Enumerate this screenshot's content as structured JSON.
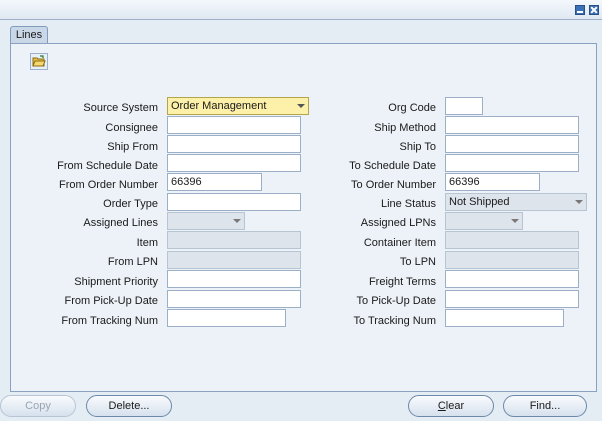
{
  "tabs": [
    {
      "label": "Lines",
      "active": true
    }
  ],
  "toolbar": {
    "icon": "folder-open-icon"
  },
  "form": {
    "left": [
      {
        "label": "Source System",
        "value": "Order Management",
        "type": "select",
        "state": "highlight"
      },
      {
        "label": "Consignee",
        "value": "",
        "type": "text",
        "state": "normal"
      },
      {
        "label": "Ship From",
        "value": "",
        "type": "text",
        "state": "normal"
      },
      {
        "label": "From Schedule Date",
        "value": "",
        "type": "text",
        "state": "normal"
      },
      {
        "label": "From Order Number",
        "value": "66396",
        "type": "text",
        "state": "normal"
      },
      {
        "label": "Order Type",
        "value": "",
        "type": "text",
        "state": "normal"
      },
      {
        "label": "Assigned Lines",
        "value": "",
        "type": "select",
        "state": "disabled"
      },
      {
        "label": "Item",
        "value": "",
        "type": "text",
        "state": "disabled"
      },
      {
        "label": "From LPN",
        "value": "",
        "type": "text",
        "state": "disabled"
      },
      {
        "label": "Shipment Priority",
        "value": "",
        "type": "text",
        "state": "normal"
      },
      {
        "label": "From Pick-Up Date",
        "value": "",
        "type": "text",
        "state": "normal"
      },
      {
        "label": "From Tracking Num",
        "value": "",
        "type": "text",
        "state": "normal"
      }
    ],
    "right": [
      {
        "label": "Org Code",
        "value": "",
        "type": "text",
        "state": "normal"
      },
      {
        "label": "Ship Method",
        "value": "",
        "type": "text",
        "state": "normal"
      },
      {
        "label": "Ship To",
        "value": "",
        "type": "text",
        "state": "normal"
      },
      {
        "label": "To Schedule Date",
        "value": "",
        "type": "text",
        "state": "normal"
      },
      {
        "label": "To Order Number",
        "value": "66396",
        "type": "text",
        "state": "normal"
      },
      {
        "label": "Line Status",
        "value": "Not Shipped",
        "type": "select",
        "state": "disabled"
      },
      {
        "label": "Assigned LPNs",
        "value": "",
        "type": "select",
        "state": "disabled"
      },
      {
        "label": "Container Item",
        "value": "",
        "type": "text",
        "state": "disabled"
      },
      {
        "label": "To LPN",
        "value": "",
        "type": "text",
        "state": "disabled"
      },
      {
        "label": "Freight Terms",
        "value": "",
        "type": "text",
        "state": "normal"
      },
      {
        "label": "To Pick-Up Date",
        "value": "",
        "type": "text",
        "state": "normal"
      },
      {
        "label": "To Tracking Num",
        "value": "",
        "type": "text",
        "state": "normal"
      }
    ]
  },
  "buttons": {
    "copy": "Copy",
    "delete": "Delete...",
    "clear_prefix": "C",
    "clear_rest": "lear",
    "find": "Find..."
  },
  "colors": {
    "background": "#e4ecf4",
    "panel": "#edf2f8",
    "highlight_field": "#fdf0a8",
    "disabled_field": "#dde4ec"
  }
}
